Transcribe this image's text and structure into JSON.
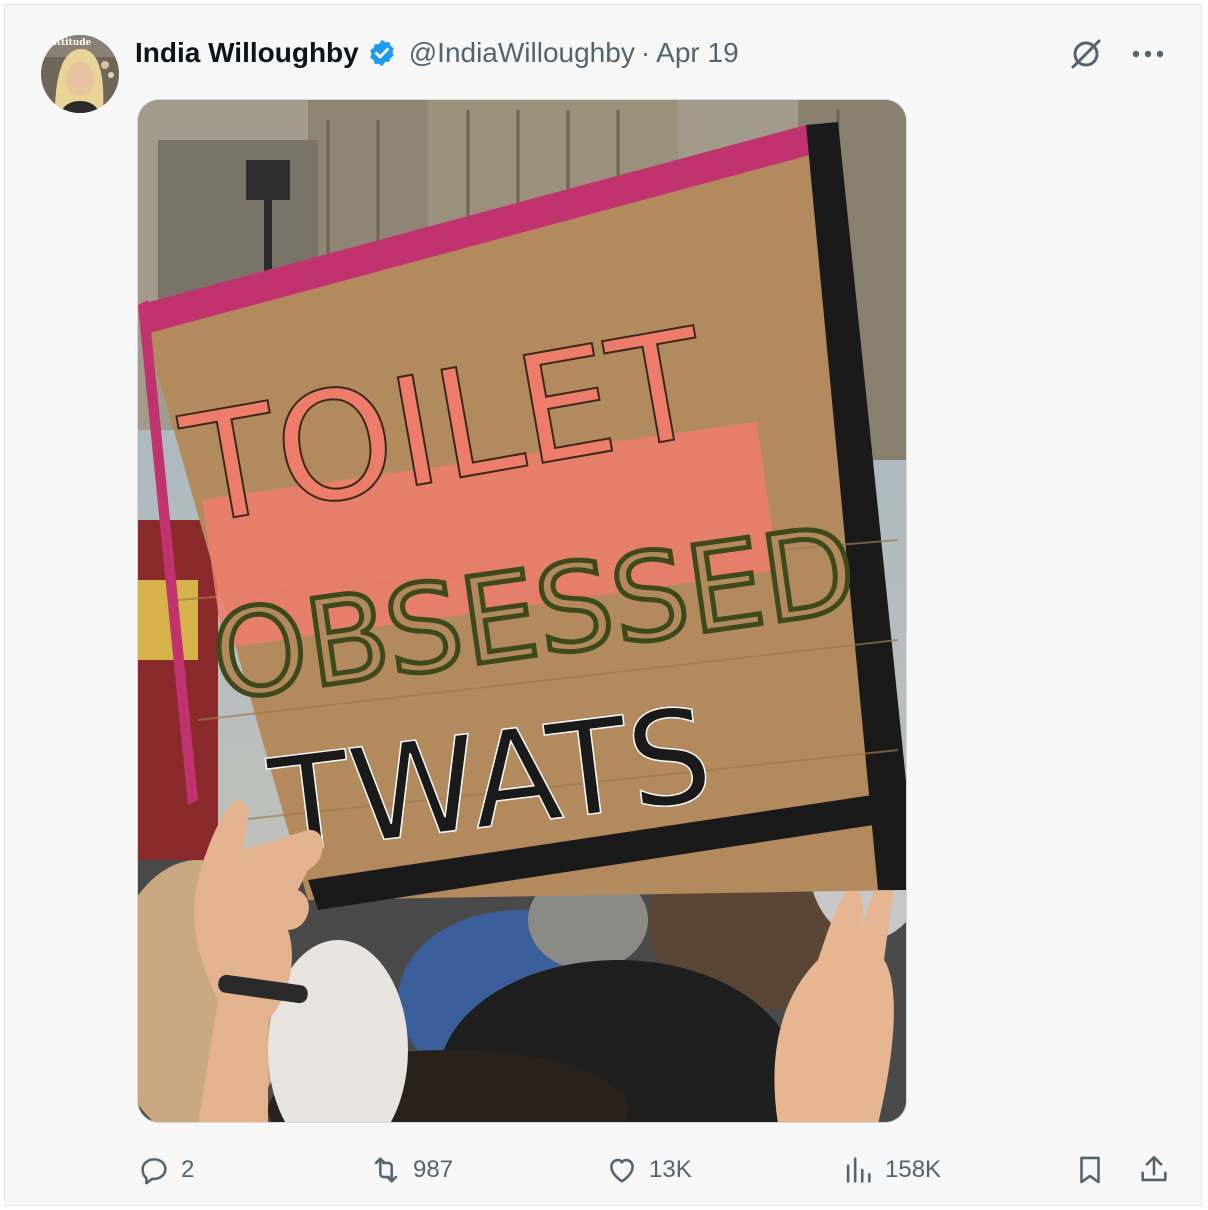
{
  "author": {
    "name": "India Willoughby",
    "handle": "@IndiaWilloughby",
    "separator": "·",
    "date": "Apr 19",
    "avatar_badge_text": "attitude",
    "verified": true
  },
  "media": {
    "sign_lines": [
      "TOILET",
      "OBSESSED",
      "TWATS"
    ],
    "colors": {
      "cardboard": "#b38a5e",
      "tape": "#c0336f",
      "pink_paint": "#ee7c6b",
      "black": "#1a1a1a"
    }
  },
  "actions": {
    "replies": "2",
    "reposts": "987",
    "likes": "13K",
    "views": "158K"
  },
  "colors": {
    "accent": "#1d9bf0",
    "muted": "#536471"
  }
}
